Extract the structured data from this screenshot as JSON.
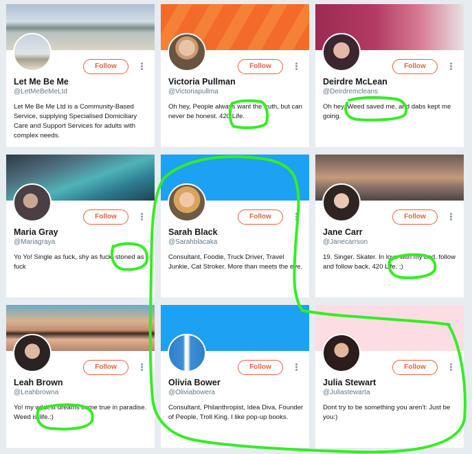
{
  "follow_label": "Follow",
  "accent_color": "#e0633a",
  "highlight_color": "#33ee22",
  "cards": [
    {
      "name": "Let Me Be Me",
      "handle": "@LetMeBeMeLtd",
      "bio": "Let Me Be Me Ltd is a Community-Based Service, supplying Specialised Domiciliary Care and Support Services for adults with complex needs.",
      "banner": "coastal landscape photo",
      "avatar": "beach photo avatar"
    },
    {
      "name": "Victoria Pullman",
      "handle": "@Victoriapullma",
      "bio": "Oh hey, People always want the truth, but can never be honest. 420 Life.",
      "banner": "orange header",
      "avatar": "woman portrait"
    },
    {
      "name": "Deirdre McLean",
      "handle": "@Deirdremcleans",
      "bio": "Oh hey. Weed saved me, and dabs kept me going.",
      "banner": "pink illustration header",
      "avatar": "woman with glasses portrait"
    },
    {
      "name": "Maria Gray",
      "handle": "@Mariagraya",
      "bio": "Yo Yo! Single as fuck, shy as fuck, stoned as fuck",
      "banner": "earth from space photo",
      "avatar": "woman portrait"
    },
    {
      "name": "Sarah Black",
      "handle": "@Sarahblacaka",
      "bio": "Consultant, Foodie, Truck Driver, Travel Junkie, Cat Stroker. More than meets the eye.",
      "banner": "blue header",
      "avatar": "blonde woman portrait"
    },
    {
      "name": "Jane Carr",
      "handle": "@Janecarrson",
      "bio": "19. Singer. Skater. In love with my bed. follow and follow back. 420 Life. ;)",
      "banner": "rain on road photo",
      "avatar": "woman portrait"
    },
    {
      "name": "Leah Brown",
      "handle": "@Leahbrowna",
      "bio": "Yo! my wildest dreams come true in paradise. Weed is life.:)",
      "banner": "woman with sunglasses photo",
      "avatar": "woman portrait"
    },
    {
      "name": "Olivia Bower",
      "handle": "@Oliviabowera",
      "bio": "Consultant, Philanthropist, Idea Diva, Founder of People, Troll King. I like pop-up books.",
      "banner": "blue header",
      "avatar": "woman standing against blue wall"
    },
    {
      "name": "Julia Stewart",
      "handle": "@Juliastewarta",
      "bio": "Dont try to be something you aren't: Just be you:)",
      "banner": "light pink header",
      "avatar": "dark-haired woman portrait"
    }
  ]
}
